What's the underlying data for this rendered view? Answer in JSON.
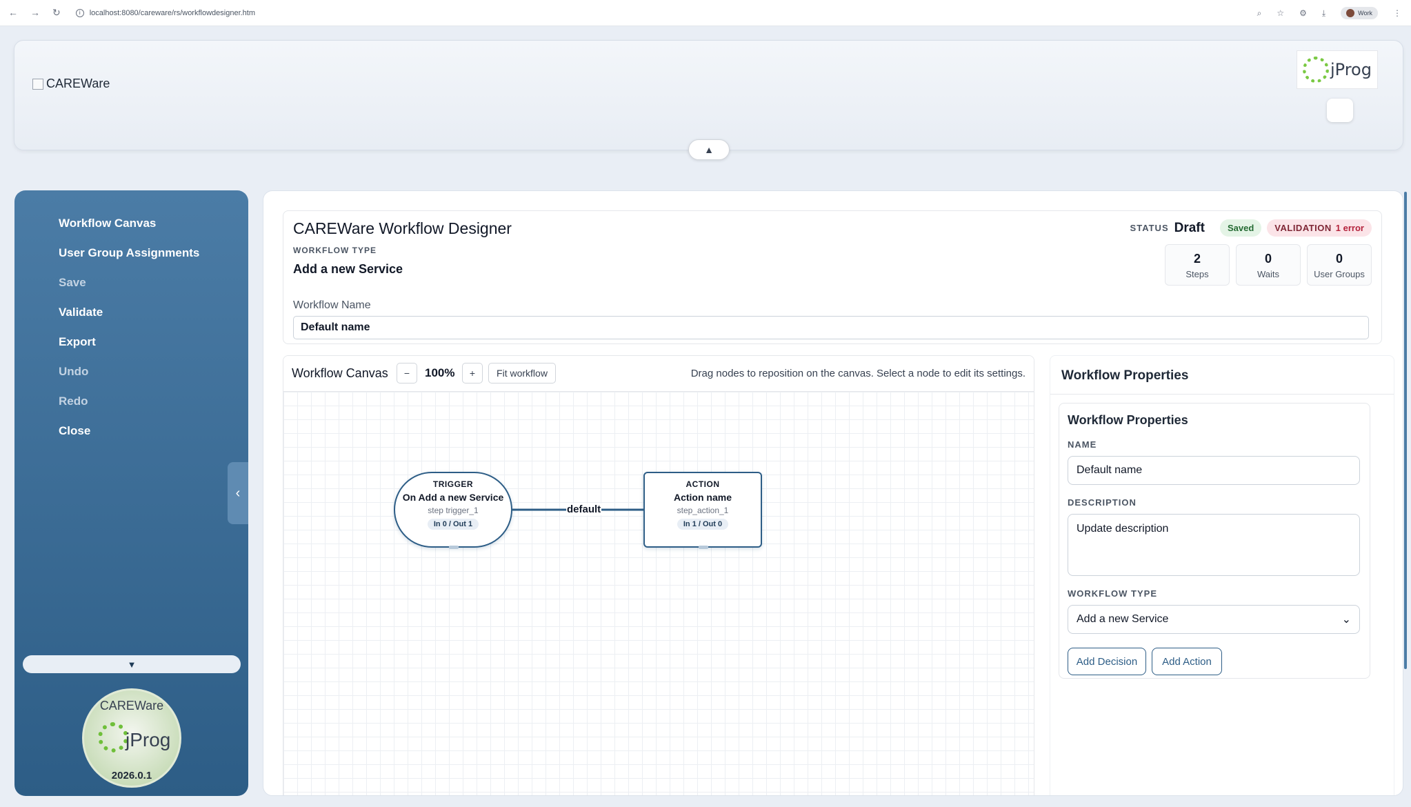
{
  "browser": {
    "url": "localhost:8080/careware/rs/workflowdesigner.htm",
    "profile_label": "Work"
  },
  "header": {
    "logo_alt": "CAREWare",
    "jprog_text": "jProg",
    "collapse_glyph": "▲"
  },
  "sidebar": {
    "items": [
      {
        "label": "Workflow Canvas",
        "enabled": true
      },
      {
        "label": "User Group Assignments",
        "enabled": true
      },
      {
        "label": "Save",
        "enabled": false
      },
      {
        "label": "Validate",
        "enabled": true
      },
      {
        "label": "Export",
        "enabled": true
      },
      {
        "label": "Undo",
        "enabled": false
      },
      {
        "label": "Redo",
        "enabled": false
      },
      {
        "label": "Close",
        "enabled": true
      }
    ],
    "toggle_glyph": "‹",
    "scroll_glyph": "▼",
    "badge": {
      "top": "CAREWare",
      "brand": "jProg",
      "version": "2026.0.1"
    }
  },
  "designer": {
    "title": "CAREWare Workflow Designer",
    "workflow_type_label": "WORKFLOW TYPE",
    "workflow_type_value": "Add a new Service",
    "status_label": "STATUS",
    "status_value": "Draft",
    "saved_badge": "Saved",
    "validation_label": "VALIDATION",
    "validation_value": "1 error",
    "stats": [
      {
        "value": "2",
        "label": "Steps"
      },
      {
        "value": "0",
        "label": "Waits"
      },
      {
        "value": "0",
        "label": "User Groups"
      }
    ],
    "workflow_name_label": "Workflow Name",
    "workflow_name_value": "Default name"
  },
  "canvas": {
    "title": "Workflow Canvas",
    "zoom_out": "−",
    "zoom": "100%",
    "zoom_in": "+",
    "fit": "Fit workflow",
    "hint": "Drag nodes to reposition on the canvas. Select a node to edit its settings.",
    "edge_label": "default",
    "nodes": [
      {
        "kind": "TRIGGER",
        "name": "On Add a new Service",
        "id": "step trigger_1",
        "io": "In 0 / Out 1"
      },
      {
        "kind": "ACTION",
        "name": "Action name",
        "id": "step_action_1",
        "io": "In 1 / Out 0"
      }
    ]
  },
  "properties": {
    "panel_title": "Workflow Properties",
    "section_title": "Workflow Properties",
    "name_label": "NAME",
    "name_value": "Default name",
    "description_label": "DESCRIPTION",
    "description_value": "Update description",
    "type_label": "WORKFLOW TYPE",
    "type_value": "Add a new Service",
    "add_decision": "Add Decision",
    "add_action": "Add Action"
  }
}
